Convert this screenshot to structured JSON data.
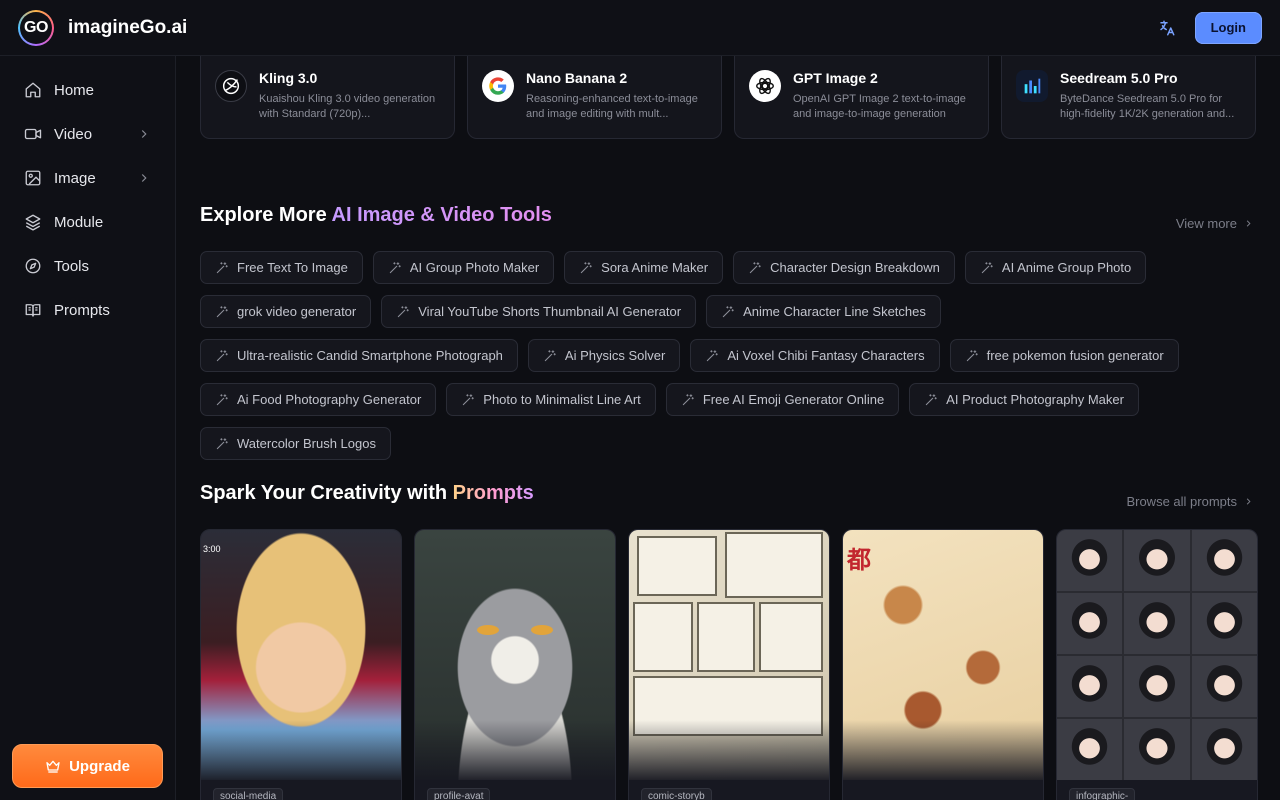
{
  "header": {
    "logo_text": "GO",
    "brand": "imagineGo.ai",
    "login_label": "Login",
    "icons": [
      "translate-icon"
    ]
  },
  "sidebar": {
    "items": [
      {
        "label": "Home",
        "icon": "home-icon",
        "has_chevron": false
      },
      {
        "label": "Video",
        "icon": "video-icon",
        "has_chevron": true
      },
      {
        "label": "Image",
        "icon": "image-icon",
        "has_chevron": true
      },
      {
        "label": "Module",
        "icon": "layers-icon",
        "has_chevron": false
      },
      {
        "label": "Tools",
        "icon": "compass-icon",
        "has_chevron": false
      },
      {
        "label": "Prompts",
        "icon": "book-icon",
        "has_chevron": false
      }
    ],
    "upgrade_label": "Upgrade"
  },
  "models": [
    {
      "title": "Kling 3.0",
      "desc": "Kuaishou Kling 3.0 video generation with Standard (720p)...",
      "icon": "kling-logo-icon"
    },
    {
      "title": "Nano Banana 2",
      "desc": "Reasoning-enhanced text-to-image and image editing with mult...",
      "icon": "google-logo-icon"
    },
    {
      "title": "GPT Image 2",
      "desc": "OpenAI GPT Image 2 text-to-image and image-to-image generation",
      "icon": "openai-logo-icon"
    },
    {
      "title": "Seedream 5.0 Pro",
      "desc": "ByteDance Seedream 5.0 Pro for high-fidelity 1K/2K generation and...",
      "icon": "seedream-logo-icon"
    }
  ],
  "explore": {
    "title_plain": "Explore More ",
    "title_highlight": "AI Image & Video Tools",
    "view_more": "View more",
    "tools": [
      "Free Text To Image",
      "AI Group Photo Maker",
      "Sora Anime Maker",
      "Character Design Breakdown",
      "AI Anime Group Photo",
      "grok video generator",
      "Viral YouTube Shorts Thumbnail AI Generator",
      "Anime Character Line Sketches",
      "Ultra-realistic Candid Smartphone Photograph",
      "Ai Physics Solver",
      "Ai Voxel Chibi Fantasy Characters",
      "free pokemon fusion generator",
      "Ai Food Photography Generator",
      "Photo to Minimalist Line Art",
      "Free AI Emoji Generator Online",
      "AI Product Photography Maker",
      "Watercolor Brush Logos"
    ]
  },
  "prompts": {
    "title_plain": "Spark Your Creativity with ",
    "title_highlight": "Prompts",
    "browse_all": "Browse all prompts",
    "cards": [
      {
        "tag": "social-media",
        "timestamp": "3:00"
      },
      {
        "tag": "profile-avat"
      },
      {
        "tag": "comic-storyb"
      },
      {
        "tag": ""
      },
      {
        "tag": "infographic-"
      }
    ]
  }
}
